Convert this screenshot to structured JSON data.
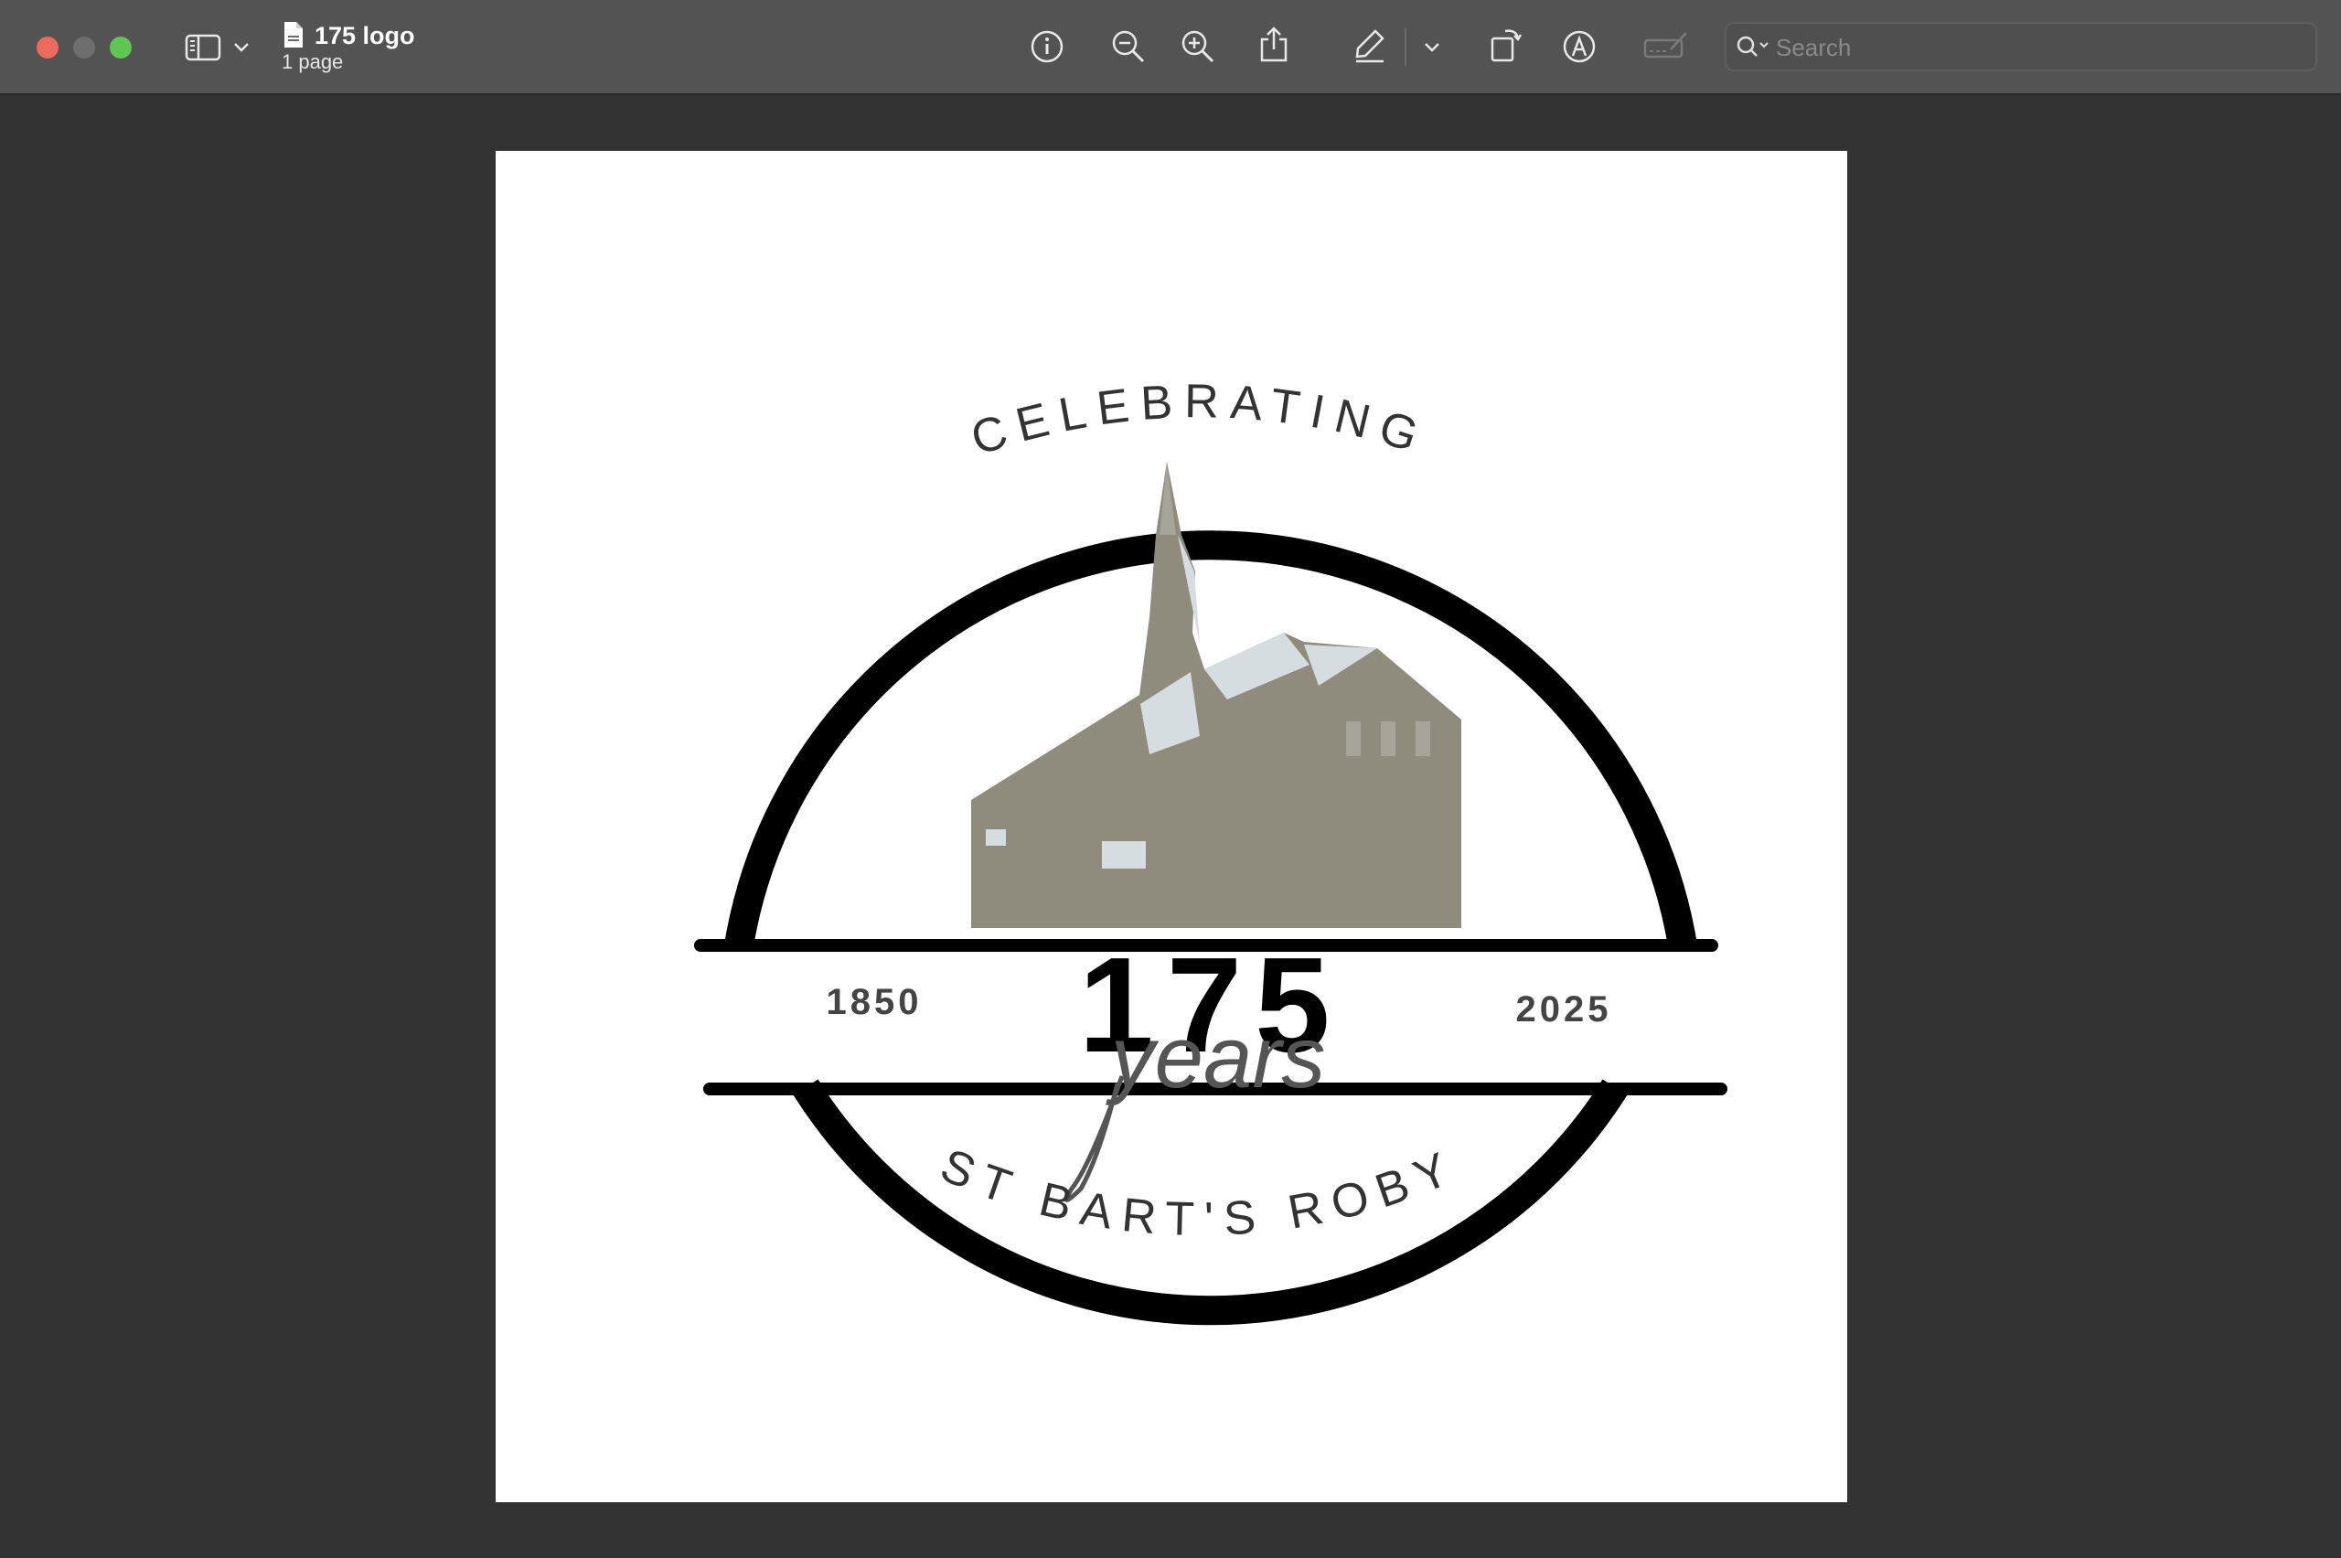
{
  "window": {
    "title": "175 logo",
    "subtitle": "1 page"
  },
  "toolbar": {
    "icons": [
      "sidebar-icon",
      "chevron-down-icon",
      "info-icon",
      "zoom-out-icon",
      "zoom-in-icon",
      "share-icon",
      "highlight-pen-icon",
      "chevron-down-icon",
      "rotate-icon",
      "markup-icon",
      "form-fill-icon"
    ]
  },
  "search": {
    "placeholder": "Search",
    "value": ""
  },
  "logo": {
    "arc_top": "CELEBRATING",
    "arc_bottom": "ST BART'S ROBY",
    "number": "175",
    "script": "years",
    "year_left": "1850",
    "year_right": "2025",
    "colors": {
      "ring": "#000000",
      "church": "#8f8b7d",
      "church_highlight": "#d5dde0"
    }
  }
}
